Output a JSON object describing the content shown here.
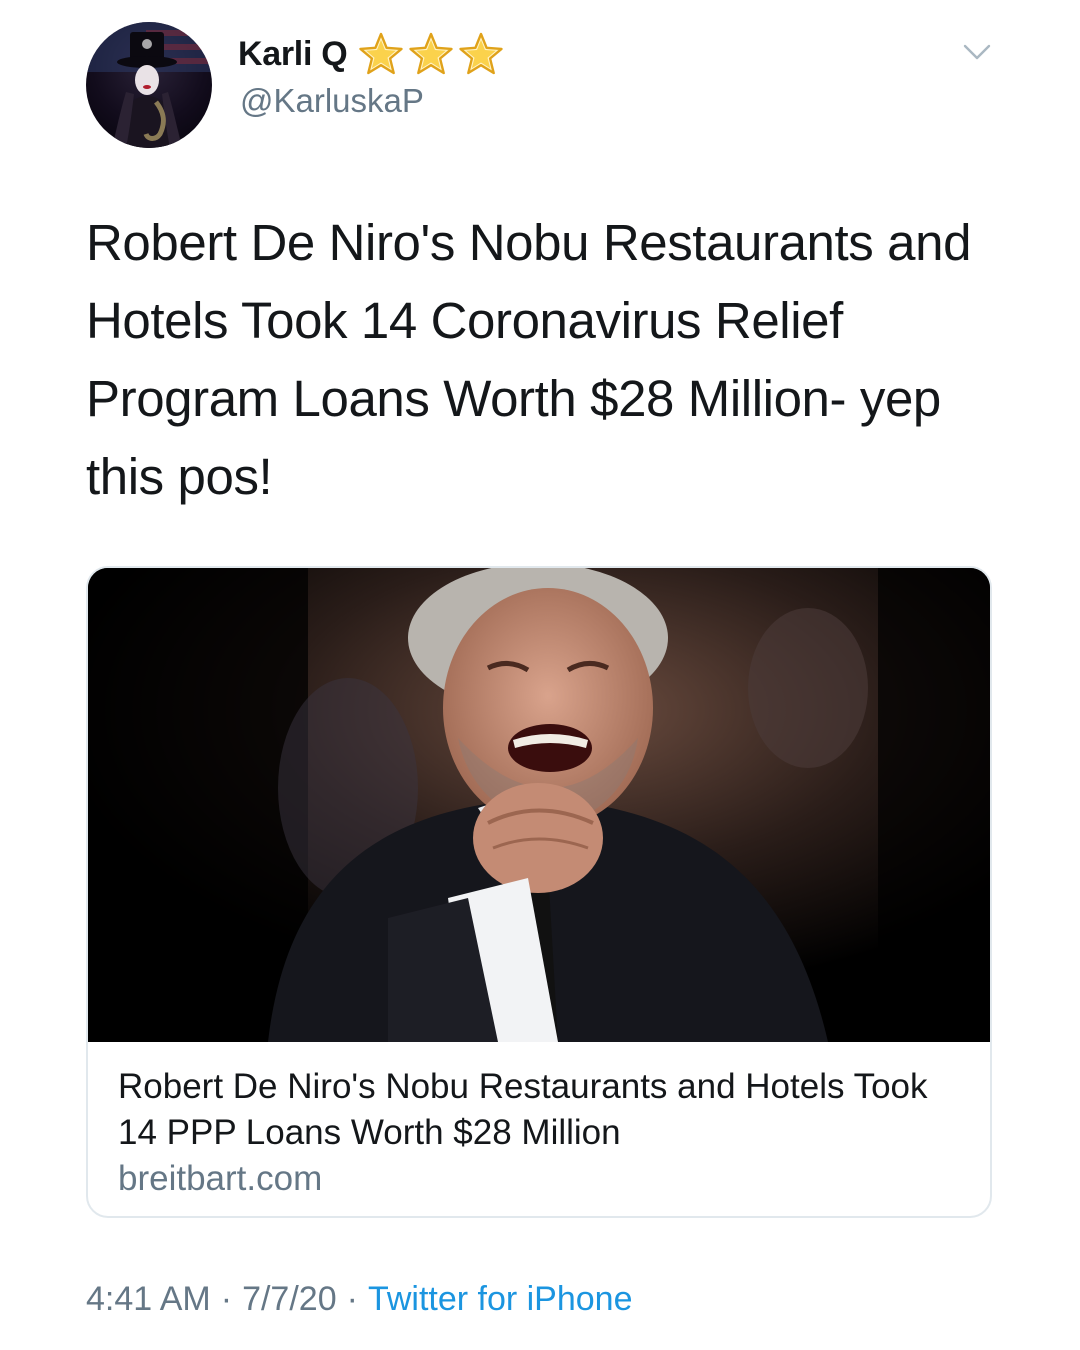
{
  "tweet": {
    "author": {
      "display_name": "Karli Q",
      "handle": "@KarluskaP",
      "badge_icons": [
        "star-icon",
        "star-icon",
        "star-icon"
      ]
    },
    "menu_icon": "chevron-down-icon",
    "text": "Robert De Niro's Nobu Restaurants and Hotels Took 14 Coronavirus Relief Program Loans Worth $28 Million- yep this pos!",
    "card": {
      "title": "Robert De Niro's Nobu Restaurants and Hotels Took 14 PPP Loans Worth $28 Million",
      "domain": "breitbart.com"
    },
    "meta": {
      "time": "4:41 AM",
      "separator": "·",
      "date": "7/7/20",
      "source": "Twitter for iPhone"
    }
  },
  "colors": {
    "text_primary": "#14171a",
    "text_secondary": "#657786",
    "link": "#1b95e0",
    "border": "#e1e8ed",
    "star_fill": "#fbd24c",
    "star_outline": "#e0a21a"
  }
}
